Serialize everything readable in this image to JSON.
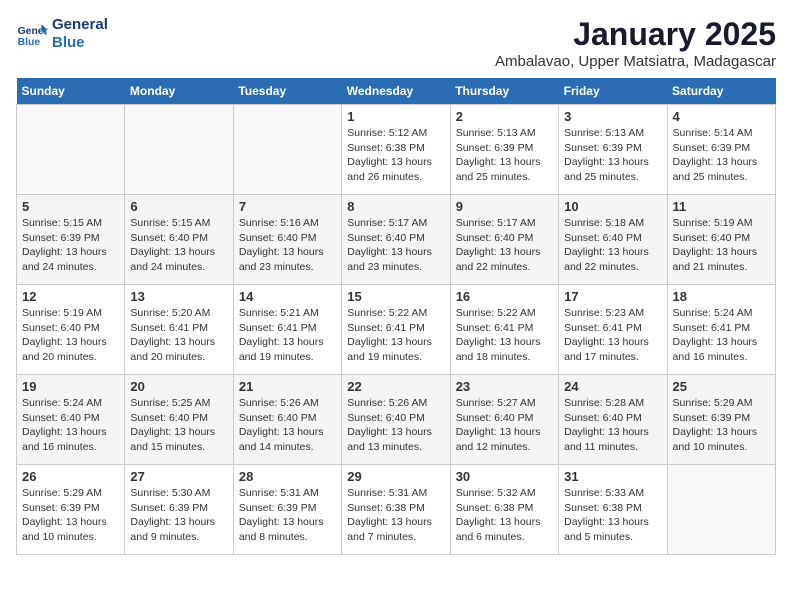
{
  "logo": {
    "line1": "General",
    "line2": "Blue"
  },
  "title": "January 2025",
  "subtitle": "Ambalavao, Upper Matsiatra, Madagascar",
  "days_of_week": [
    "Sunday",
    "Monday",
    "Tuesday",
    "Wednesday",
    "Thursday",
    "Friday",
    "Saturday"
  ],
  "weeks": [
    [
      {
        "day": "",
        "info": ""
      },
      {
        "day": "",
        "info": ""
      },
      {
        "day": "",
        "info": ""
      },
      {
        "day": "1",
        "info": "Sunrise: 5:12 AM\nSunset: 6:38 PM\nDaylight: 13 hours\nand 26 minutes."
      },
      {
        "day": "2",
        "info": "Sunrise: 5:13 AM\nSunset: 6:39 PM\nDaylight: 13 hours\nand 25 minutes."
      },
      {
        "day": "3",
        "info": "Sunrise: 5:13 AM\nSunset: 6:39 PM\nDaylight: 13 hours\nand 25 minutes."
      },
      {
        "day": "4",
        "info": "Sunrise: 5:14 AM\nSunset: 6:39 PM\nDaylight: 13 hours\nand 25 minutes."
      }
    ],
    [
      {
        "day": "5",
        "info": "Sunrise: 5:15 AM\nSunset: 6:39 PM\nDaylight: 13 hours\nand 24 minutes."
      },
      {
        "day": "6",
        "info": "Sunrise: 5:15 AM\nSunset: 6:40 PM\nDaylight: 13 hours\nand 24 minutes."
      },
      {
        "day": "7",
        "info": "Sunrise: 5:16 AM\nSunset: 6:40 PM\nDaylight: 13 hours\nand 23 minutes."
      },
      {
        "day": "8",
        "info": "Sunrise: 5:17 AM\nSunset: 6:40 PM\nDaylight: 13 hours\nand 23 minutes."
      },
      {
        "day": "9",
        "info": "Sunrise: 5:17 AM\nSunset: 6:40 PM\nDaylight: 13 hours\nand 22 minutes."
      },
      {
        "day": "10",
        "info": "Sunrise: 5:18 AM\nSunset: 6:40 PM\nDaylight: 13 hours\nand 22 minutes."
      },
      {
        "day": "11",
        "info": "Sunrise: 5:19 AM\nSunset: 6:40 PM\nDaylight: 13 hours\nand 21 minutes."
      }
    ],
    [
      {
        "day": "12",
        "info": "Sunrise: 5:19 AM\nSunset: 6:40 PM\nDaylight: 13 hours\nand 20 minutes."
      },
      {
        "day": "13",
        "info": "Sunrise: 5:20 AM\nSunset: 6:41 PM\nDaylight: 13 hours\nand 20 minutes."
      },
      {
        "day": "14",
        "info": "Sunrise: 5:21 AM\nSunset: 6:41 PM\nDaylight: 13 hours\nand 19 minutes."
      },
      {
        "day": "15",
        "info": "Sunrise: 5:22 AM\nSunset: 6:41 PM\nDaylight: 13 hours\nand 19 minutes."
      },
      {
        "day": "16",
        "info": "Sunrise: 5:22 AM\nSunset: 6:41 PM\nDaylight: 13 hours\nand 18 minutes."
      },
      {
        "day": "17",
        "info": "Sunrise: 5:23 AM\nSunset: 6:41 PM\nDaylight: 13 hours\nand 17 minutes."
      },
      {
        "day": "18",
        "info": "Sunrise: 5:24 AM\nSunset: 6:41 PM\nDaylight: 13 hours\nand 16 minutes."
      }
    ],
    [
      {
        "day": "19",
        "info": "Sunrise: 5:24 AM\nSunset: 6:40 PM\nDaylight: 13 hours\nand 16 minutes."
      },
      {
        "day": "20",
        "info": "Sunrise: 5:25 AM\nSunset: 6:40 PM\nDaylight: 13 hours\nand 15 minutes."
      },
      {
        "day": "21",
        "info": "Sunrise: 5:26 AM\nSunset: 6:40 PM\nDaylight: 13 hours\nand 14 minutes."
      },
      {
        "day": "22",
        "info": "Sunrise: 5:26 AM\nSunset: 6:40 PM\nDaylight: 13 hours\nand 13 minutes."
      },
      {
        "day": "23",
        "info": "Sunrise: 5:27 AM\nSunset: 6:40 PM\nDaylight: 13 hours\nand 12 minutes."
      },
      {
        "day": "24",
        "info": "Sunrise: 5:28 AM\nSunset: 6:40 PM\nDaylight: 13 hours\nand 11 minutes."
      },
      {
        "day": "25",
        "info": "Sunrise: 5:29 AM\nSunset: 6:39 PM\nDaylight: 13 hours\nand 10 minutes."
      }
    ],
    [
      {
        "day": "26",
        "info": "Sunrise: 5:29 AM\nSunset: 6:39 PM\nDaylight: 13 hours\nand 10 minutes."
      },
      {
        "day": "27",
        "info": "Sunrise: 5:30 AM\nSunset: 6:39 PM\nDaylight: 13 hours\nand 9 minutes."
      },
      {
        "day": "28",
        "info": "Sunrise: 5:31 AM\nSunset: 6:39 PM\nDaylight: 13 hours\nand 8 minutes."
      },
      {
        "day": "29",
        "info": "Sunrise: 5:31 AM\nSunset: 6:38 PM\nDaylight: 13 hours\nand 7 minutes."
      },
      {
        "day": "30",
        "info": "Sunrise: 5:32 AM\nSunset: 6:38 PM\nDaylight: 13 hours\nand 6 minutes."
      },
      {
        "day": "31",
        "info": "Sunrise: 5:33 AM\nSunset: 6:38 PM\nDaylight: 13 hours\nand 5 minutes."
      },
      {
        "day": "",
        "info": ""
      }
    ]
  ]
}
